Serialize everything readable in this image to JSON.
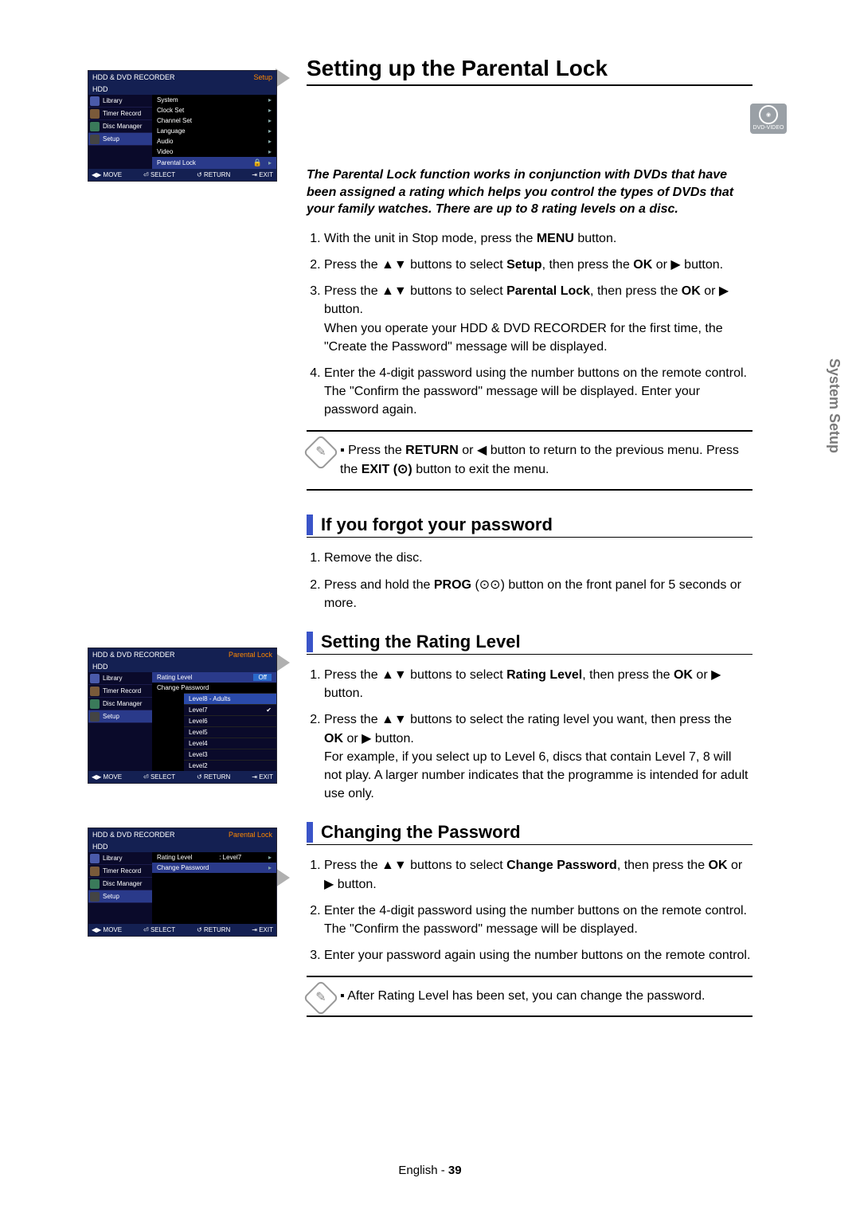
{
  "section_tab": "System Setup",
  "title": "Setting up the Parental Lock",
  "dvd_badge": "DVD-VIDEO",
  "intro": "The Parental Lock function works in conjunction with DVDs that have been assigned a rating which helps you control the types of DVDs that your family watches. There are up to 8 rating levels on a disc.",
  "steps_main": [
    "With the unit in Stop mode, press the MENU button.",
    "Press the ▲▼ buttons to select Setup, then press the OK or ▶ button.",
    "Press the ▲▼ buttons to select Parental Lock, then press the OK or ▶ button.\nWhen you operate your HDD & DVD RECORDER for the first time, the \"Create the Password\" message will be displayed.",
    "Enter the 4-digit password using the number buttons on the remote control.\nThe \"Confirm the password\" message will be displayed. Enter your password again."
  ],
  "note1": [
    "Press the RETURN or ◀ button to return to the previous menu. Press the EXIT (⊙) button to exit the menu."
  ],
  "sub_forgot": "If you forgot your password",
  "steps_forgot": [
    "Remove the disc.",
    "Press and hold the PROG (⊙⊙) button on the front panel for 5 seconds or more."
  ],
  "sub_rating": "Setting the Rating Level",
  "steps_rating": [
    "Press the ▲▼ buttons to select Rating Level, then press the OK or ▶ button.",
    "Press the ▲▼ buttons to select the rating level you want, then press the OK or ▶ button.\nFor example, if you select up to Level 6, discs that contain Level 7, 8 will not play. A larger number indicates that the programme is intended for adult use only."
  ],
  "sub_change": "Changing the Password",
  "steps_change": [
    "Press the ▲▼ buttons to select Change Password, then press the OK or ▶ button.",
    "Enter the 4-digit password using the number buttons on the remote control. The \"Confirm the password\" message will be displayed.",
    "Enter your password again using the number buttons on the remote control."
  ],
  "note2": [
    "After Rating Level has been set, you can change the password."
  ],
  "footer_lang": "English",
  "footer_page": "39",
  "osd1": {
    "header_left": "HDD & DVD RECORDER",
    "header_right": "Setup",
    "hdd": "HDD",
    "side": [
      "Library",
      "Timer Record",
      "Disc Manager",
      "Setup"
    ],
    "main": [
      "System",
      "Clock Set",
      "Channel Set",
      "Language",
      "Audio",
      "Video",
      "Parental Lock"
    ],
    "footer": [
      "◀▶ MOVE",
      "⏎ SELECT",
      "↺ RETURN",
      "⇥ EXIT"
    ]
  },
  "osd2": {
    "header_left": "HDD & DVD RECORDER",
    "header_right": "Parental Lock",
    "hdd": "HDD",
    "side": [
      "Library",
      "Timer Record",
      "Disc Manager",
      "Setup"
    ],
    "main_rows": [
      {
        "label": "Rating Level",
        "value": "Off"
      },
      {
        "label": "Change Password",
        "value": ""
      }
    ],
    "levels": [
      "Level8 - Adults",
      "Level7",
      "Level6",
      "Level5",
      "Level4",
      "Level3",
      "Level2"
    ],
    "level_sel": "Level8 - Adults",
    "level_check": "Level7",
    "footer": [
      "◀▶ MOVE",
      "⏎ SELECT",
      "↺ RETURN",
      "⇥ EXIT"
    ]
  },
  "osd3": {
    "header_left": "HDD & DVD RECORDER",
    "header_right": "Parental Lock",
    "hdd": "HDD",
    "side": [
      "Library",
      "Timer Record",
      "Disc Manager",
      "Setup"
    ],
    "main_rows": [
      {
        "label": "Rating Level",
        "value": ": Level7"
      },
      {
        "label": "Change Password",
        "value": ""
      }
    ],
    "footer": [
      "◀▶ MOVE",
      "⏎ SELECT",
      "↺ RETURN",
      "⇥ EXIT"
    ]
  }
}
